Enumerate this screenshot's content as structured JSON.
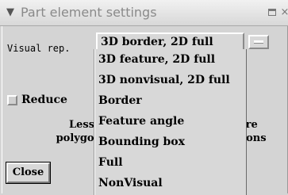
{
  "window": {
    "title": "Part element settings",
    "menu_icon": "chevron-down-icon",
    "maximize_icon": "maximize-icon",
    "close_icon": "close-icon",
    "close_glyph": "×"
  },
  "visual_rep": {
    "label": "Visual rep.",
    "selected": "3D border, 2D full",
    "options": [
      "3D feature, 2D full",
      "3D nonvisual, 2D full",
      "Border",
      "Feature angle",
      "Bounding box",
      "Full",
      "NonVisual"
    ]
  },
  "reduce": {
    "label": "Reduce",
    "checked": false
  },
  "slider": {
    "less_label": "Less polygons",
    "more_label": "More polygons",
    "less_line1": "Less",
    "less_line2": "polygons",
    "more_line1": "ore",
    "more_line2": "gons"
  },
  "buttons": {
    "close_label": "Close"
  }
}
